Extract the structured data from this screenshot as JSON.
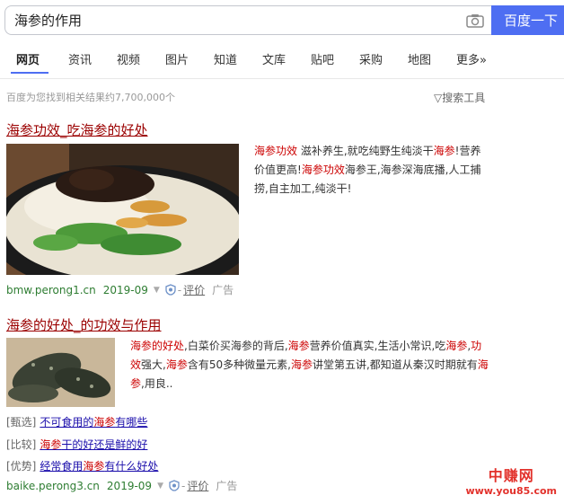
{
  "search": {
    "query": "海参的作用",
    "button_label": "百度一下",
    "camera_icon": "camera-icon"
  },
  "tabs": [
    "网页",
    "资讯",
    "视频",
    "图片",
    "知道",
    "文库",
    "贴吧",
    "采购",
    "地图",
    "更多»"
  ],
  "result_count": "百度为您找到相关结果约7,700,000个",
  "search_tools": "搜索工具",
  "results": [
    {
      "title": "海参功效_吃海参的好处",
      "abstract": [
        {
          "t": "海参功效",
          "em": true
        },
        {
          "t": " 滋补养生,就吃纯野生纯淡干",
          "em": false
        },
        {
          "t": "海参",
          "em": true
        },
        {
          "t": "!营养价值更高!",
          "em": false
        },
        {
          "t": "海参功效",
          "em": true
        },
        {
          "t": "海参王,海参深海底播,人工捕捞,自主加工,纯淡干!",
          "em": false
        }
      ],
      "url": "bmw.perong1.cn",
      "date": "2019-09",
      "review": "评价",
      "ad": "广告"
    },
    {
      "title": "海参的好处_的功效与作用",
      "abstract": [
        {
          "t": "海参的好处",
          "em": true
        },
        {
          "t": ",白菜价买海参的背后,",
          "em": false
        },
        {
          "t": "海参",
          "em": true
        },
        {
          "t": "营养价值真实,生活小常识,吃",
          "em": false
        },
        {
          "t": "海参",
          "em": true
        },
        {
          "t": ",",
          "em": false
        },
        {
          "t": "功效",
          "em": true
        },
        {
          "t": "强大,",
          "em": false
        },
        {
          "t": "海参",
          "em": true
        },
        {
          "t": "含有50多种微量元素,",
          "em": false
        },
        {
          "t": "海参",
          "em": true
        },
        {
          "t": "讲堂第五讲,都知道从秦汉时期就有",
          "em": false
        },
        {
          "t": "海参",
          "em": true
        },
        {
          "t": ",用良..",
          "em": false
        }
      ],
      "related": [
        {
          "tag": "[甄选]",
          "pre": "不可食用的",
          "em": "海参",
          "post": "有哪些"
        },
        {
          "tag": "[比较]",
          "pre": "",
          "em": "海参",
          "post": "干的好还是鲜的好"
        },
        {
          "tag": "[优势]",
          "pre": "经常食用",
          "em": "海参",
          "post": "有什么好处"
        }
      ],
      "url": "baike.perong3.cn",
      "date": "2019-09",
      "review": "评价",
      "ad": "广告"
    }
  ],
  "watermark": {
    "line1": "中赚网",
    "line2": "www.you85.com"
  }
}
